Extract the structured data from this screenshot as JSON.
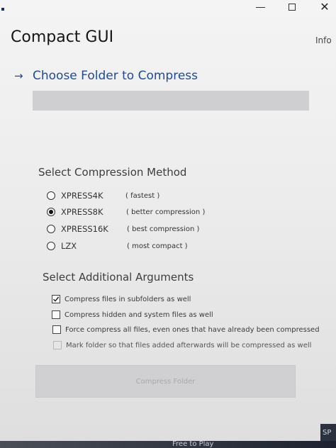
{
  "window": {
    "controls": {
      "minimize_icon": "minimize-icon",
      "maximize_icon": "maximize-icon",
      "close_icon": "close-icon",
      "close_glyph": "✕"
    }
  },
  "header": {
    "title": "Compact GUI",
    "info_label": "Info"
  },
  "folder": {
    "arrow_glyph": "→",
    "choose_label": "Choose Folder to Compress",
    "selected_path": ""
  },
  "method": {
    "heading": "Select Compression Method",
    "options": [
      {
        "label": "XPRESS4K",
        "description": "( fastest )",
        "selected": false
      },
      {
        "label": "XPRESS8K",
        "description": "( better compression )",
        "selected": true
      },
      {
        "label": "XPRESS16K",
        "description": "( best compression )",
        "selected": false
      },
      {
        "label": "LZX",
        "description": "( most compact )",
        "selected": false
      }
    ]
  },
  "arguments": {
    "heading": "Select Additional Arguments",
    "options": [
      {
        "label": "Compress files in subfolders as well",
        "checked": true,
        "enabled": true
      },
      {
        "label": "Compress hidden and system files as well",
        "checked": false,
        "enabled": true
      },
      {
        "label": "Force compress all files, even ones that have already been compressed",
        "checked": false,
        "enabled": true
      },
      {
        "label": "Mark folder so that files added afterwards will be compressed as well",
        "checked": false,
        "enabled": false
      }
    ]
  },
  "actions": {
    "compress_label": "Compress Folder"
  },
  "background": {
    "taskbar_text": "Free to Play",
    "edge_text": "SP"
  }
}
